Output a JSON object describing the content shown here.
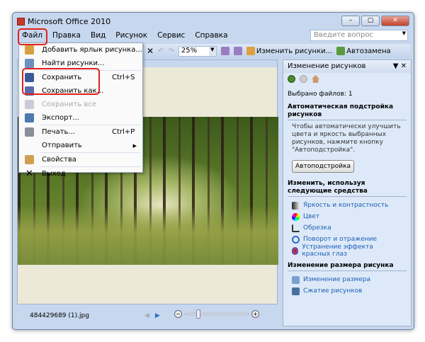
{
  "window": {
    "title": "Microsoft Office 2010",
    "min": "–",
    "max": "▢",
    "close": "✕"
  },
  "menubar": [
    "Файл",
    "Правка",
    "Вид",
    "Рисунок",
    "Сервис",
    "Справка"
  ],
  "ask": {
    "placeholder": "Введите вопрос"
  },
  "toolbar": {
    "zoom": "25%",
    "edit_pictures": "Изменить рисунки...",
    "autocorrect": "Автозамена"
  },
  "file_menu": [
    {
      "label": "Добавить ярлык рисунка...",
      "shortcut": "",
      "icon": "add-shortcut-icon",
      "disabled": false
    },
    {
      "label": "Найти рисунки...",
      "shortcut": "",
      "icon": "find-pictures-icon",
      "disabled": false
    },
    {
      "label": "Сохранить",
      "shortcut": "Ctrl+S",
      "icon": "save-icon",
      "disabled": false
    },
    {
      "label": "Сохранить как...",
      "shortcut": "",
      "icon": "save-as-icon",
      "disabled": false
    },
    {
      "label": "Сохранить все",
      "shortcut": "",
      "icon": "save-all-icon",
      "disabled": true
    },
    {
      "label": "Экспорт...",
      "shortcut": "",
      "icon": "export-icon",
      "disabled": false
    },
    {
      "label": "Печать...",
      "shortcut": "Ctrl+P",
      "icon": "print-icon",
      "disabled": false
    },
    {
      "label": "Отправить",
      "shortcut": "",
      "icon": "",
      "disabled": false,
      "submenu": true
    },
    {
      "label": "Свойства",
      "shortcut": "",
      "icon": "properties-icon",
      "disabled": false
    },
    {
      "label": "Выход",
      "shortcut": "",
      "icon": "exit-icon",
      "disabled": false
    }
  ],
  "status": {
    "filename": "484429689 (1).jpg",
    "zoom_level_fraction": 0.2
  },
  "pane": {
    "title": "Изменение рисунков",
    "selected": "Выбрано файлов: 1",
    "auto_section": "Автоматическая подстройка рисунков",
    "auto_desc": "Чтобы автоматически улучшить цвета и яркость выбранных рисунков, нажмите кнопку \"Автоподстройка\".",
    "auto_button": "Автоподстройка",
    "tools_section": "Изменить, используя следующие средства",
    "tools": [
      "Яркость и контрастность",
      "Цвет",
      "Обрезка",
      "Поворот и отражение",
      "Устранение эффекта красных глаз"
    ],
    "resize_section": "Изменение размера рисунка",
    "resize": [
      "Изменение размера",
      "Сжатие рисунков"
    ]
  },
  "highlight_color": "#e0211c"
}
